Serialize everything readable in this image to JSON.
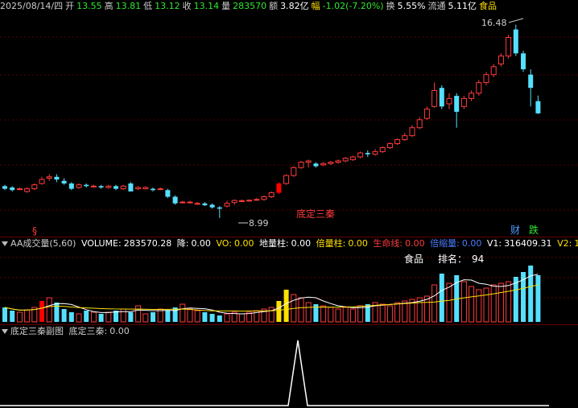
{
  "quote_bar": {
    "date": "2025/08/14/四",
    "open_label": "开",
    "open": "13.55",
    "high_label": "高",
    "high": "13.81",
    "low_label": "低",
    "low": "13.12",
    "close_label": "收",
    "close": "13.14",
    "volume_label": "量",
    "volume": "283570",
    "amount_label": "额",
    "amount": "3.82亿",
    "change_label": "幅",
    "change": "-1.02(-7.20%)",
    "turnover_label": "换",
    "turnover": "5.55%",
    "float_label": "流通",
    "float": "5.11亿",
    "sector": "食品"
  },
  "main_chart": {
    "high_mark": "16.48",
    "low_mark": "8.99",
    "signal_label": "底定三秦",
    "bottom_marks": [
      "§",
      "财",
      "跌"
    ]
  },
  "volume_panel": {
    "title": "AA成交量(5,60)",
    "items": [
      {
        "label": "VOLUME:",
        "value": "283570.28"
      },
      {
        "label": "降:",
        "value": "0.00"
      },
      {
        "label": "VO:",
        "value": "0.00"
      },
      {
        "label": "地量柱:",
        "value": "0.00"
      },
      {
        "label": "倍量柱:",
        "value": "0.00"
      },
      {
        "label": "生命线:",
        "value": "0.00"
      },
      {
        "label": "倍缩量:",
        "value": "0.00"
      },
      {
        "label": "V1:",
        "value": "316409.31"
      },
      {
        "label": "V2:",
        "value": "1"
      }
    ],
    "sector": "食品",
    "rank_label": "排名：",
    "rank": "94"
  },
  "sub_panel": {
    "title": "底定三秦副图",
    "item_label": "底定三秦:",
    "item_value": "0.00"
  },
  "colors": {
    "up": "#ff3b3b",
    "down": "#55e0ff",
    "volume_ma": "#ffffff",
    "volume_ma2": "#ffe000",
    "signal": "#ff0000"
  }
}
